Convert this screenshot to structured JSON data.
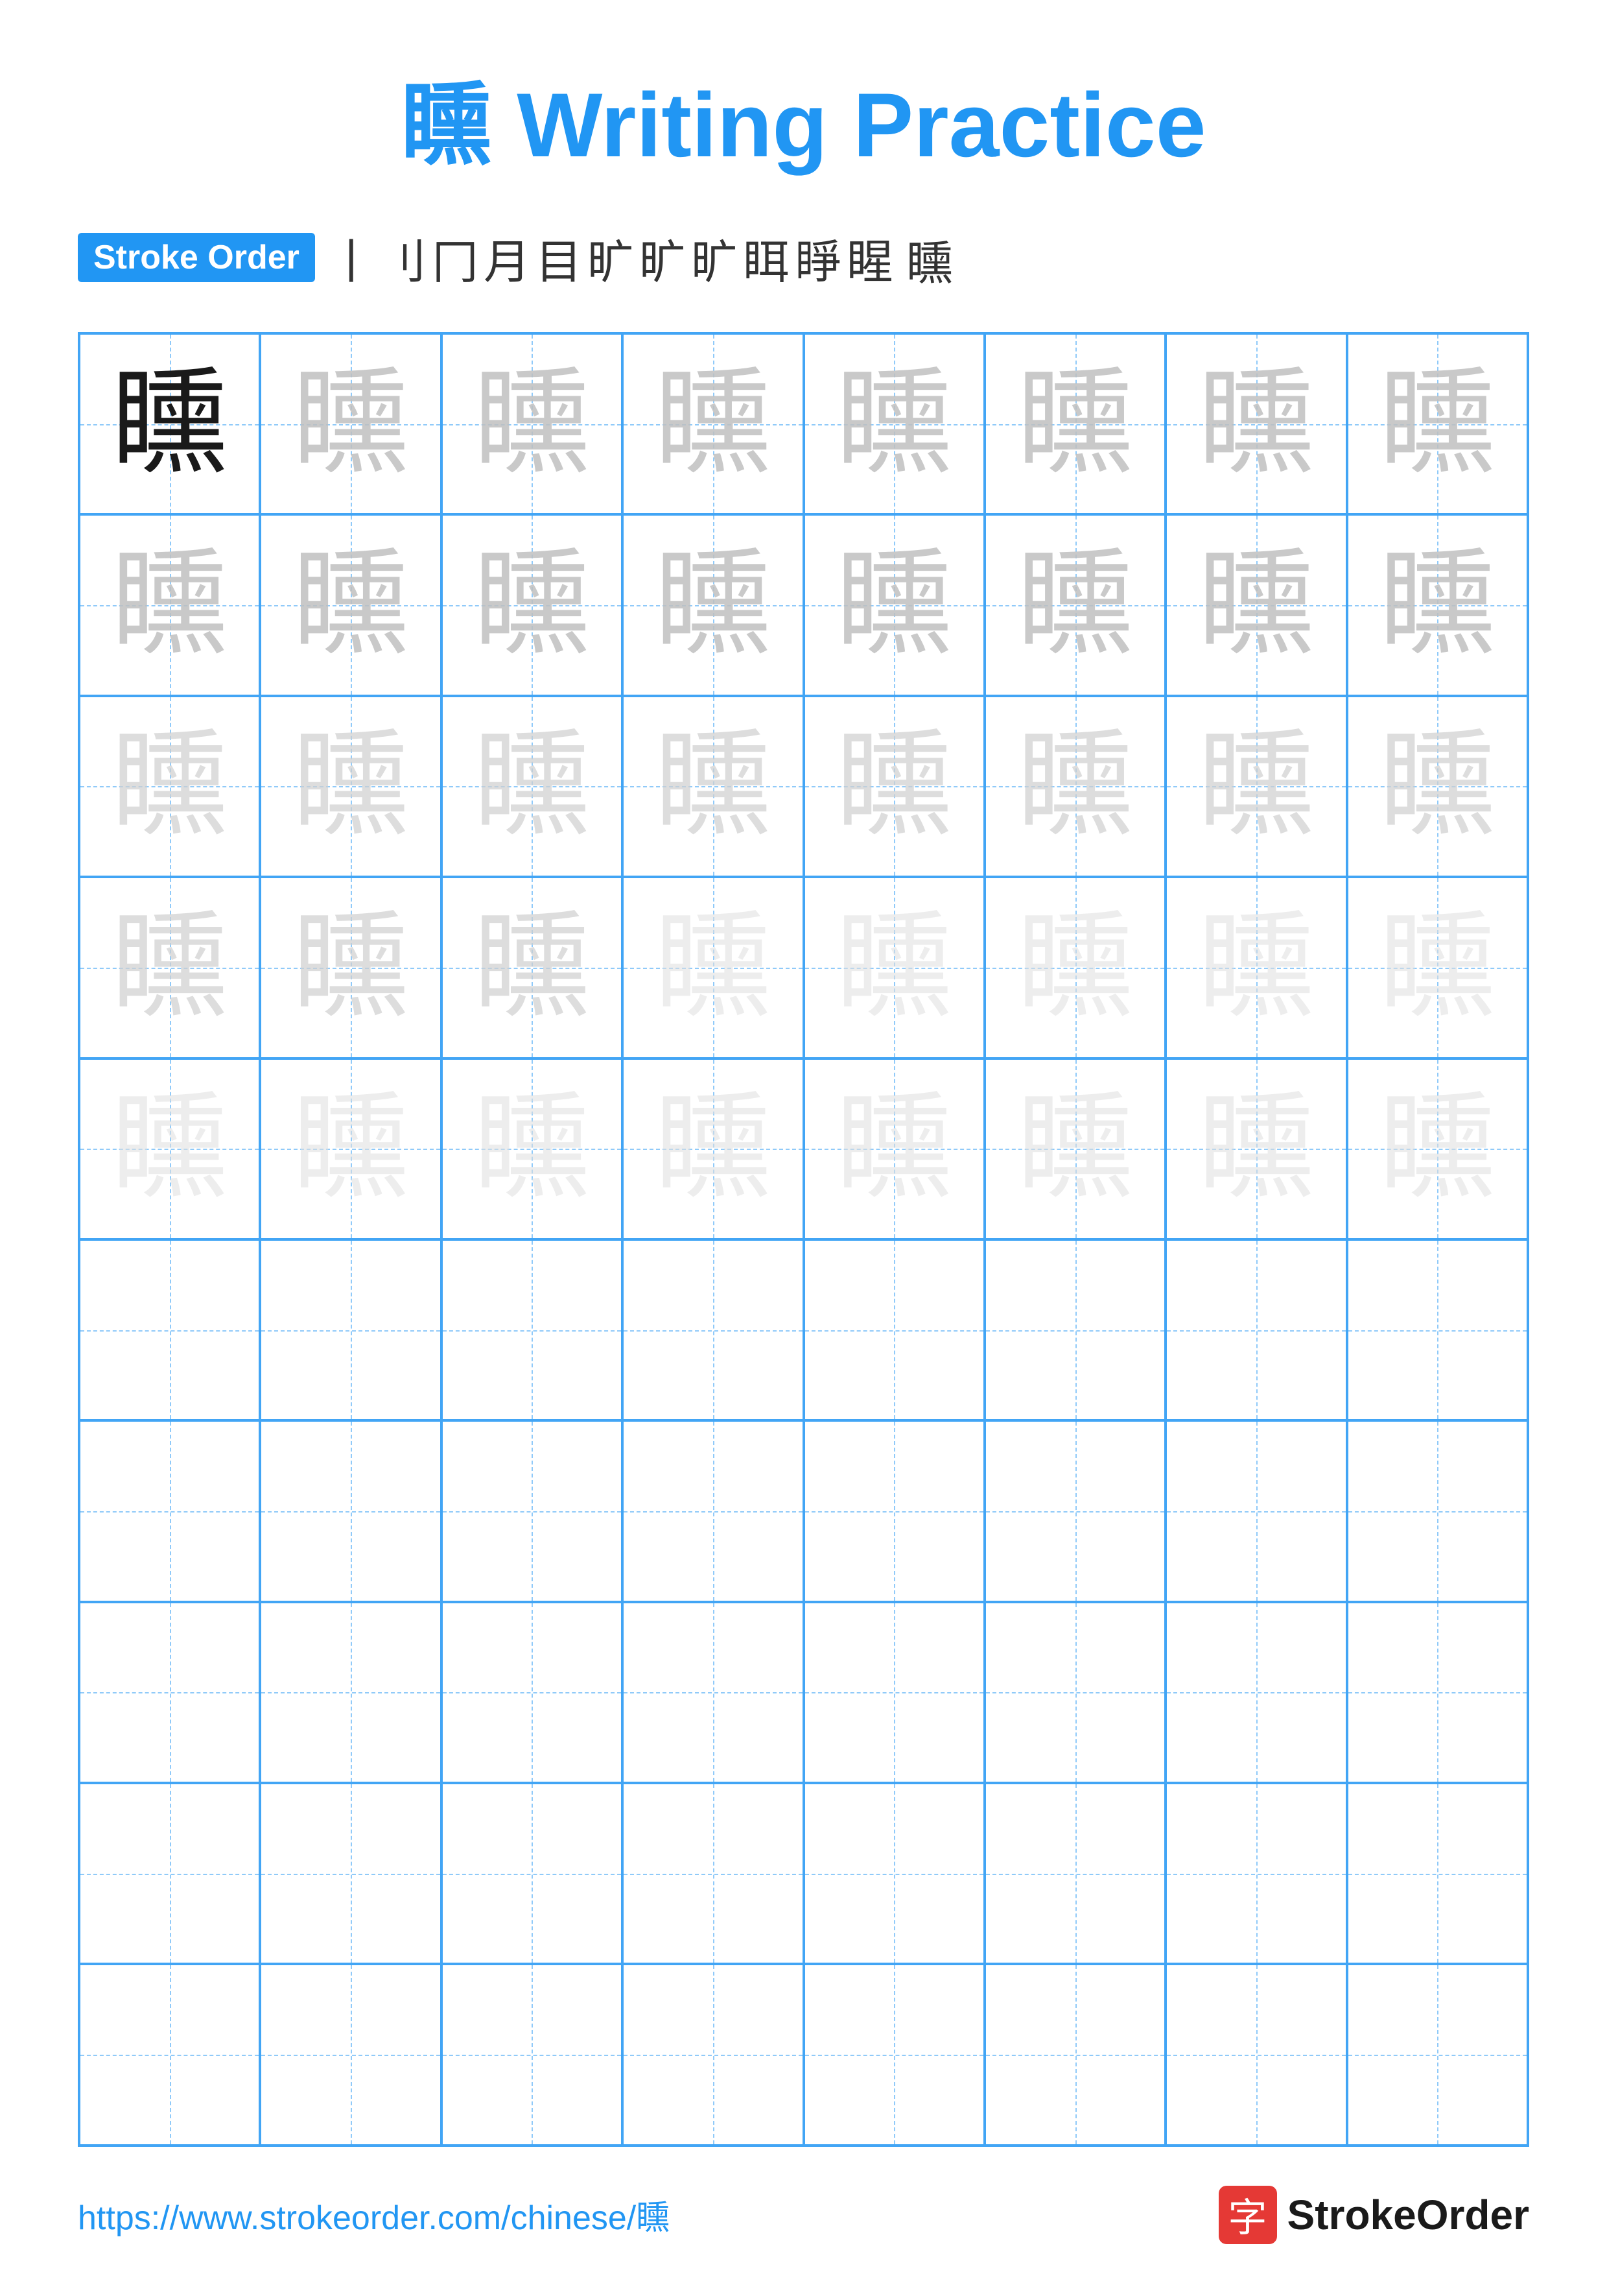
{
  "title": "矄 Writing Practice",
  "stroke_order_label": "Stroke Order",
  "character": "矄",
  "stroke_sequence": [
    "丨",
    "刂",
    "冂",
    "月",
    "目",
    "旷",
    "旷",
    "旷",
    "眲",
    "睜",
    "睲",
    "矄"
  ],
  "footer_url": "https://www.strokeorder.com/chinese/矄",
  "footer_logo_char": "字",
  "footer_logo_text": "StrokeOrder",
  "grid": {
    "rows": 10,
    "cols": 8,
    "practice_char": "矄",
    "filled_rows": 5
  }
}
